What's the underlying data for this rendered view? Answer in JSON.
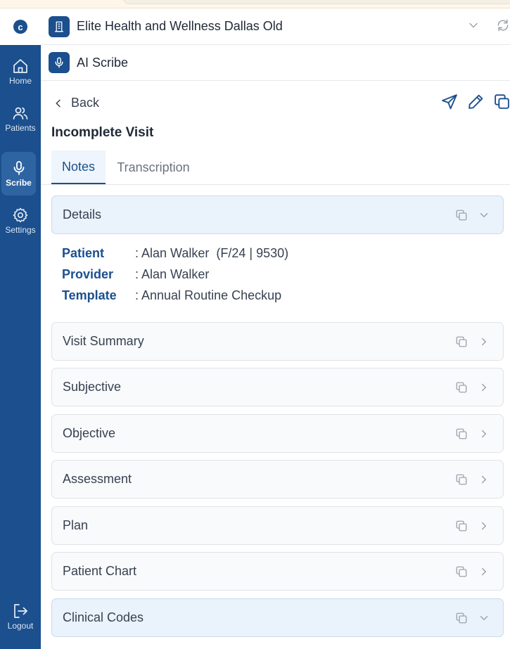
{
  "app": {
    "org_name": "Elite Health and Wellness Dallas Old",
    "module_title": "AI Scribe"
  },
  "sidebar": {
    "items": [
      {
        "label": "Home",
        "icon": "home-icon",
        "active": false
      },
      {
        "label": "Patients",
        "icon": "users-icon",
        "active": false
      },
      {
        "label": "Scribe",
        "icon": "microphone-icon",
        "active": true
      },
      {
        "label": "Settings",
        "icon": "gear-icon",
        "active": false
      }
    ],
    "logout_label": "Logout"
  },
  "page": {
    "back_label": "Back",
    "visit_title": "Incomplete Visit",
    "tabs": [
      {
        "label": "Notes",
        "active": true
      },
      {
        "label": "Transcription",
        "active": false
      }
    ]
  },
  "details": {
    "header": "Details",
    "rows": [
      {
        "key": "Patient",
        "value": ": Alan Walker  (F/24 | 9530)"
      },
      {
        "key": "Provider",
        "value": ": Alan Walker"
      },
      {
        "key": "Template",
        "value": ": Annual Routine Checkup"
      }
    ]
  },
  "sections": [
    {
      "label": "Visit Summary"
    },
    {
      "label": "Subjective"
    },
    {
      "label": "Objective"
    },
    {
      "label": "Assessment"
    },
    {
      "label": "Plan"
    },
    {
      "label": "Patient Chart"
    },
    {
      "label": "Clinical Codes"
    }
  ],
  "colors": {
    "brand": "#1b4f8d",
    "sidebar_active": "#2f64a3",
    "section_open_bg": "#eaf2fb"
  }
}
